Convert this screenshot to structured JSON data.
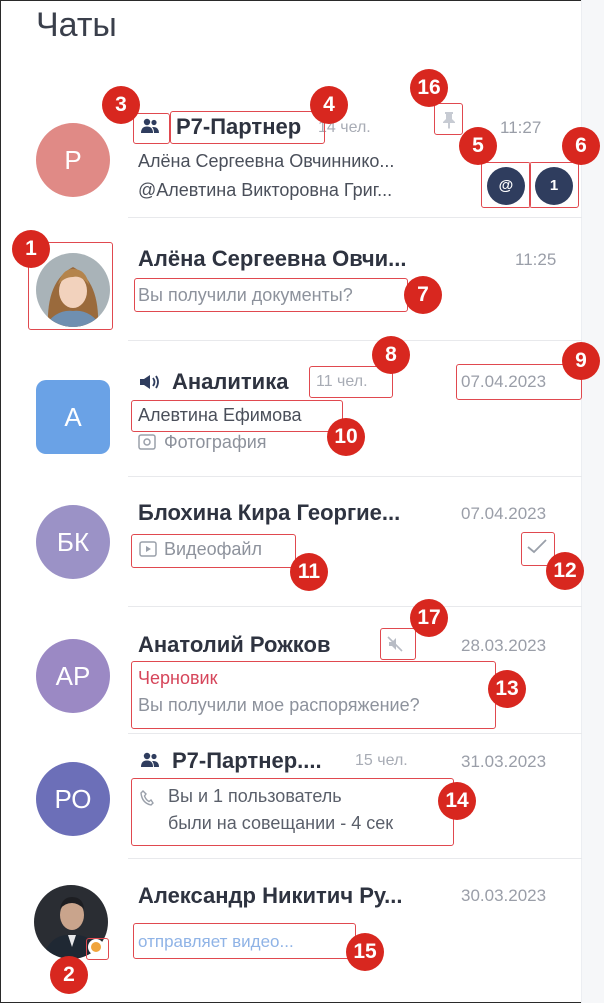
{
  "header": {
    "title": "Чаты"
  },
  "chats": [
    {
      "avatar": "Р",
      "avatar_color": "#e08a86",
      "name": "Р7-Партнер",
      "members": "14 чел.",
      "time": "11:27",
      "line1": "Алёна Сергеевна Овчиннико...",
      "line2": "@Алевтина Викторовна Григ...",
      "mention_badge": "@",
      "unread_badge": "1",
      "icons": [
        "group-icon",
        "pin-icon"
      ]
    },
    {
      "avatar_photo": true,
      "name": "Алёна Сергеевна Овчи...",
      "time": "11:25",
      "line1": "Вы получили документы?"
    },
    {
      "avatar": "А",
      "avatar_color": "#6aa2e6",
      "name": "Аналитика",
      "members": "11 чел.",
      "time": "07.04.2023",
      "line1": "Алевтина Ефимова",
      "line2": "Фотография",
      "icons": [
        "channel-icon",
        "photo-icon"
      ]
    },
    {
      "avatar": "БК",
      "avatar_color": "#9b92c6",
      "name": "Блохина Кира Георгие...",
      "time": "07.04.2023",
      "line1": "Видеофайл",
      "icons": [
        "video-icon",
        "check-icon"
      ]
    },
    {
      "avatar": "АР",
      "avatar_color": "#9b89c4",
      "name": "Анатолий Рожков",
      "time": "28.03.2023",
      "line1": "Черновик",
      "line2": "Вы получили мое распоряжение?",
      "icons": [
        "muted-icon"
      ]
    },
    {
      "avatar": "РО",
      "avatar_color": "#6c6fb8",
      "name": "Р7-Партнер....",
      "members": "15 чел.",
      "time": "31.03.2023",
      "line1": "Вы и 1 пользователь",
      "line2": "были на совещании - 4 сек",
      "icons": [
        "group-icon",
        "phone-icon"
      ]
    },
    {
      "avatar_photo": true,
      "name": "Александр Никитич Ру...",
      "time": "30.03.2023",
      "line1": "отправляет видео...",
      "status_color": "#f0a43c"
    }
  ],
  "callouts": [
    "1",
    "2",
    "3",
    "4",
    "5",
    "6",
    "7",
    "8",
    "9",
    "10",
    "11",
    "12",
    "13",
    "14",
    "15",
    "16",
    "17"
  ]
}
